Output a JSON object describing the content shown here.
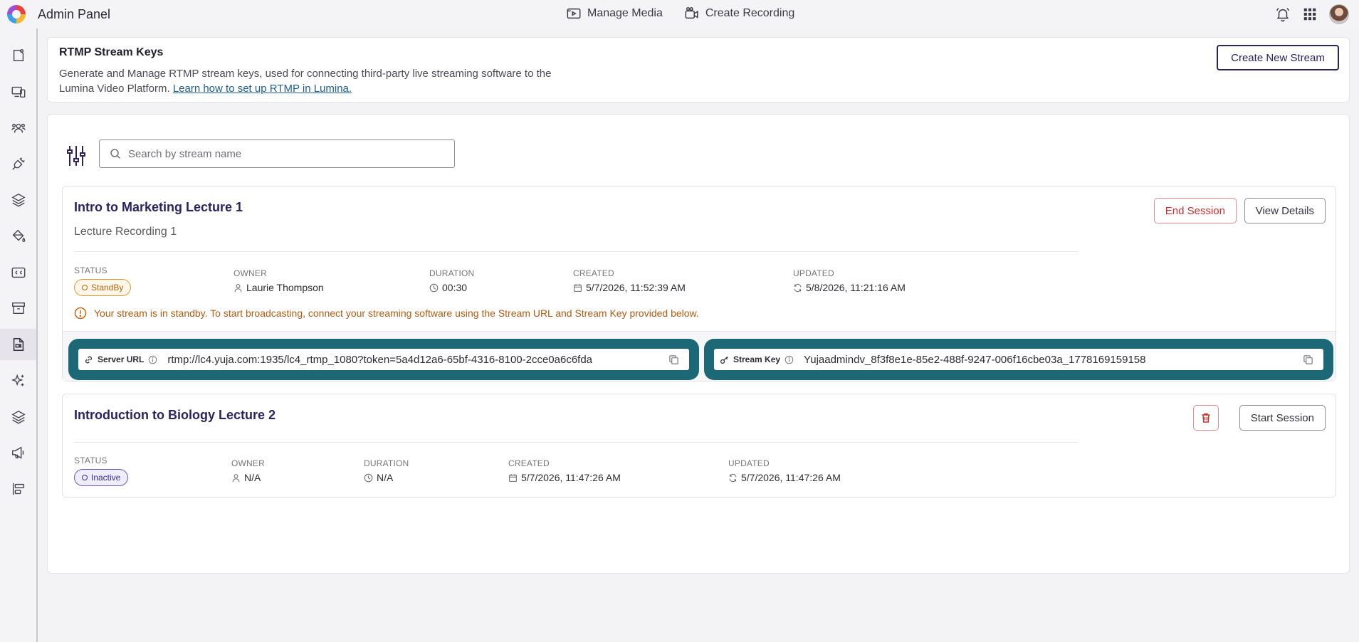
{
  "app": {
    "title": "Admin Panel"
  },
  "topnav": {
    "manage_media": "Manage Media",
    "create_recording": "Create Recording"
  },
  "header": {
    "title": "RTMP Stream Keys",
    "description": "Generate and Manage RTMP stream keys, used for connecting third-party live streaming software to the Lumina Video Platform.",
    "link": "Learn how to set up RTMP in Lumina.",
    "create_button": "Create New Stream"
  },
  "search": {
    "placeholder": "Search by stream name"
  },
  "labels": {
    "status": "STATUS",
    "owner": "OWNER",
    "duration": "DURATION",
    "created": "CREATED",
    "updated": "UPDATED"
  },
  "streams": [
    {
      "title": "Intro to Marketing Lecture 1",
      "subtitle": "Lecture Recording 1",
      "status": "StandBy",
      "owner": "Laurie Thompson",
      "duration": "00:30",
      "created": "5/7/2026, 11:52:39 AM",
      "updated": "5/8/2026, 11:21:16 AM",
      "warning": "Your stream is in standby. To start broadcasting, connect your streaming software using the Stream URL and Stream Key provided below.",
      "end_session": "End Session",
      "view_details": "View Details",
      "server_url_label": "Server URL",
      "server_url": "rtmp://lc4.yuja.com:1935/lc4_rtmp_1080?token=5a4d12a6-65bf-4316-8100-2cce0a6c6fda",
      "stream_key_label": "Stream Key",
      "stream_key": "Yujaadmindv_8f3f8e1e-85e2-488f-9247-006f16cbe03a_1778169159158"
    },
    {
      "title": "Introduction to Biology Lecture 2",
      "status": "Inactive",
      "owner": "N/A",
      "duration": "N/A",
      "created": "5/7/2026, 11:47:26 AM",
      "updated": "5/7/2026, 11:47:26 AM",
      "start_session": "Start Session"
    }
  ],
  "colors": {
    "accent": "#2e2259",
    "key_strip": "#1d6877",
    "danger": "#c9302c",
    "standby": "#e09a2f",
    "inactive": "#6e5bbf"
  }
}
